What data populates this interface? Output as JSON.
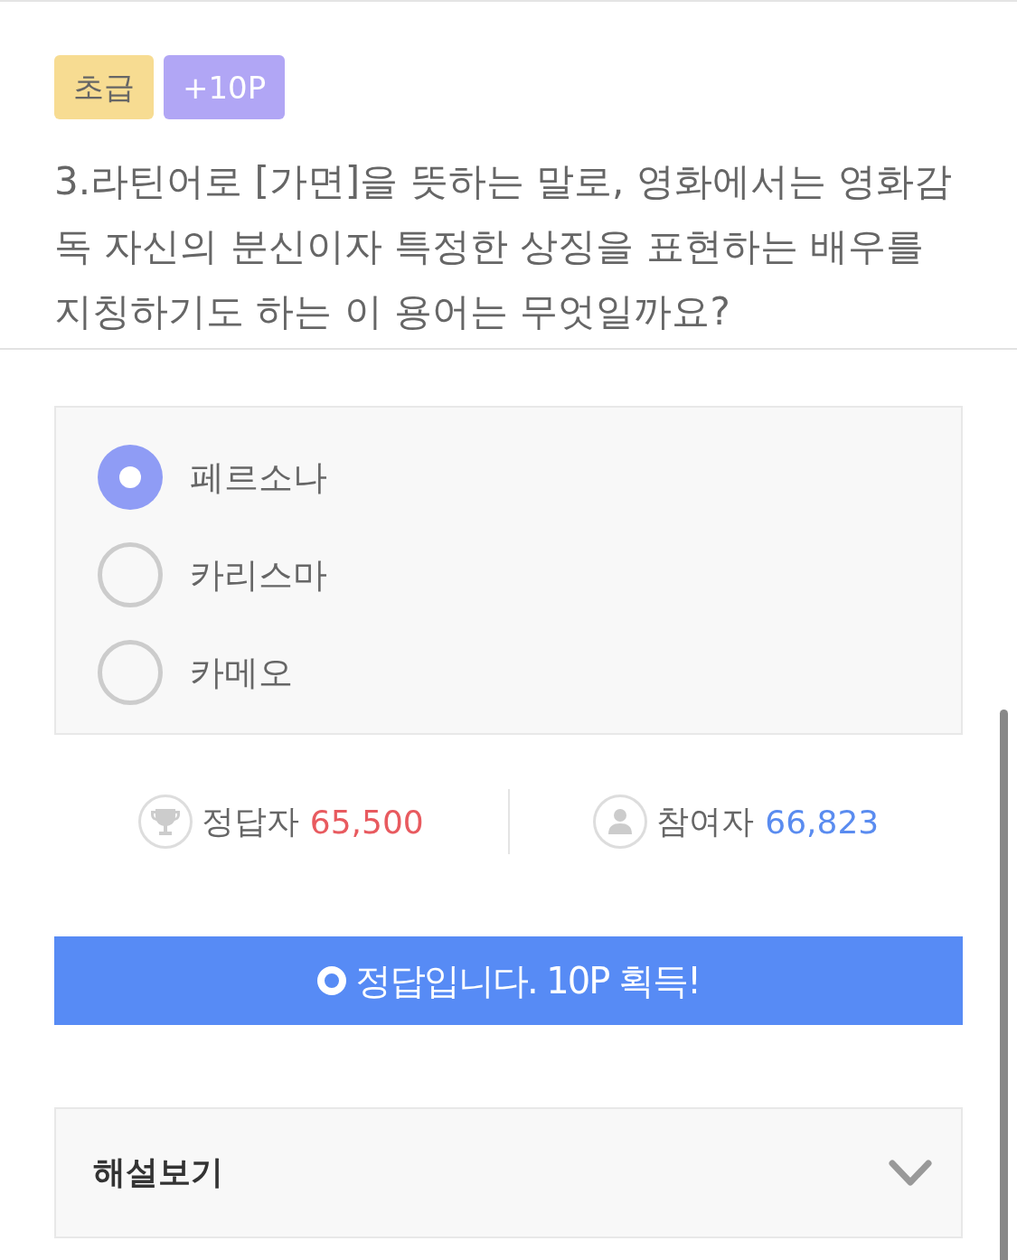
{
  "tags": [
    {
      "kind": "level",
      "label": "초급",
      "color": "#f7dc92"
    },
    {
      "kind": "points",
      "label": "+10P",
      "color": "#b1a6f5"
    }
  ],
  "question": "3.라틴어로 [가면]을 뜻하는 말로, 영화에서는 영화감독 자신의 분신이자 특정한 상징을 표현하는 배우를 지칭하기도 하는 이 용어는 무엇일까요?",
  "options": [
    {
      "label": "페르소나",
      "selected": true
    },
    {
      "label": "카리스마",
      "selected": false
    },
    {
      "label": "카메오",
      "selected": false
    }
  ],
  "stats": [
    {
      "kind": "correct",
      "label": "정답자",
      "count": "65,500",
      "color": "#e85a5f"
    },
    {
      "kind": "participants",
      "label": "참여자",
      "count": "66,823",
      "color": "#5a8cf0"
    }
  ],
  "result_banner": {
    "text": "정답입니다. 10P 획득!"
  },
  "explanation": {
    "label": "해설보기",
    "expanded": false
  }
}
